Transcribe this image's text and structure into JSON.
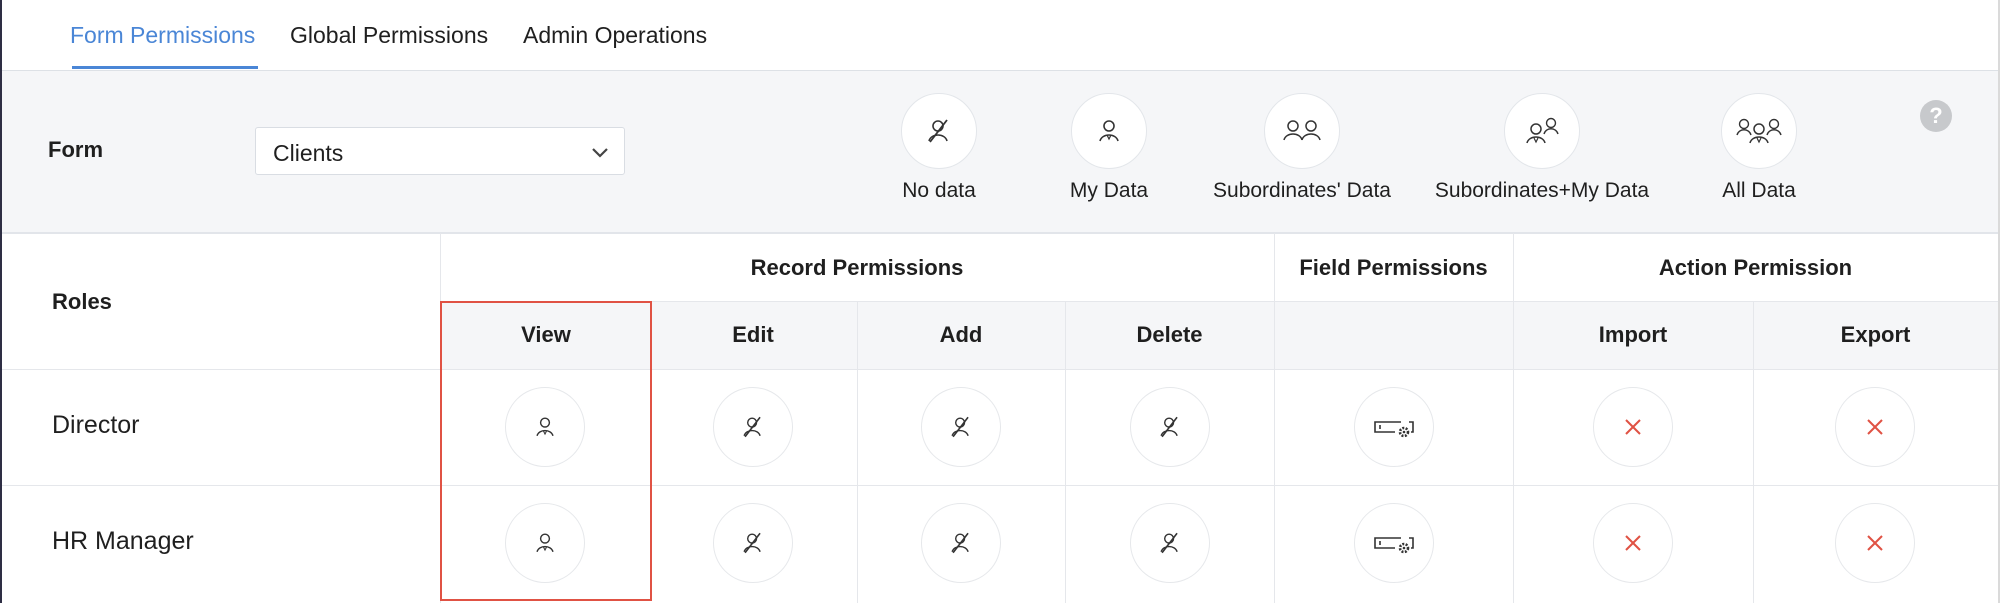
{
  "tabs": [
    {
      "label": "Form Permissions",
      "active": true
    },
    {
      "label": "Global Permissions",
      "active": false
    },
    {
      "label": "Admin Operations",
      "active": false
    }
  ],
  "form_selector": {
    "label": "Form",
    "selected": "Clients"
  },
  "legend": [
    {
      "label": "No data",
      "icon": "no-data-icon"
    },
    {
      "label": "My Data",
      "icon": "my-data-icon"
    },
    {
      "label": "Subordinates' Data",
      "icon": "subordinates-data-icon"
    },
    {
      "label": "Subordinates+My Data",
      "icon": "subordinates-my-data-icon"
    },
    {
      "label": "All Data",
      "icon": "all-data-icon"
    }
  ],
  "help": "?",
  "table": {
    "roles_header": "Roles",
    "groups": {
      "record": "Record Permissions",
      "field": "Field Permissions",
      "action": "Action Permission"
    },
    "columns": [
      "View",
      "Edit",
      "Add",
      "Delete",
      "",
      "Import",
      "Export"
    ],
    "rows": [
      {
        "role": "Director",
        "cells": [
          "my-data-icon",
          "no-data-icon",
          "no-data-icon",
          "no-data-icon",
          "field-settings-icon",
          "cross-icon",
          "cross-icon"
        ]
      },
      {
        "role": "HR Manager",
        "cells": [
          "my-data-icon",
          "no-data-icon",
          "no-data-icon",
          "no-data-icon",
          "field-settings-icon",
          "cross-icon",
          "cross-icon"
        ]
      }
    ]
  },
  "colors": {
    "accent": "#4a86d6",
    "highlight": "#e05244",
    "cross": "#e05244",
    "band": "#f5f6f8"
  }
}
